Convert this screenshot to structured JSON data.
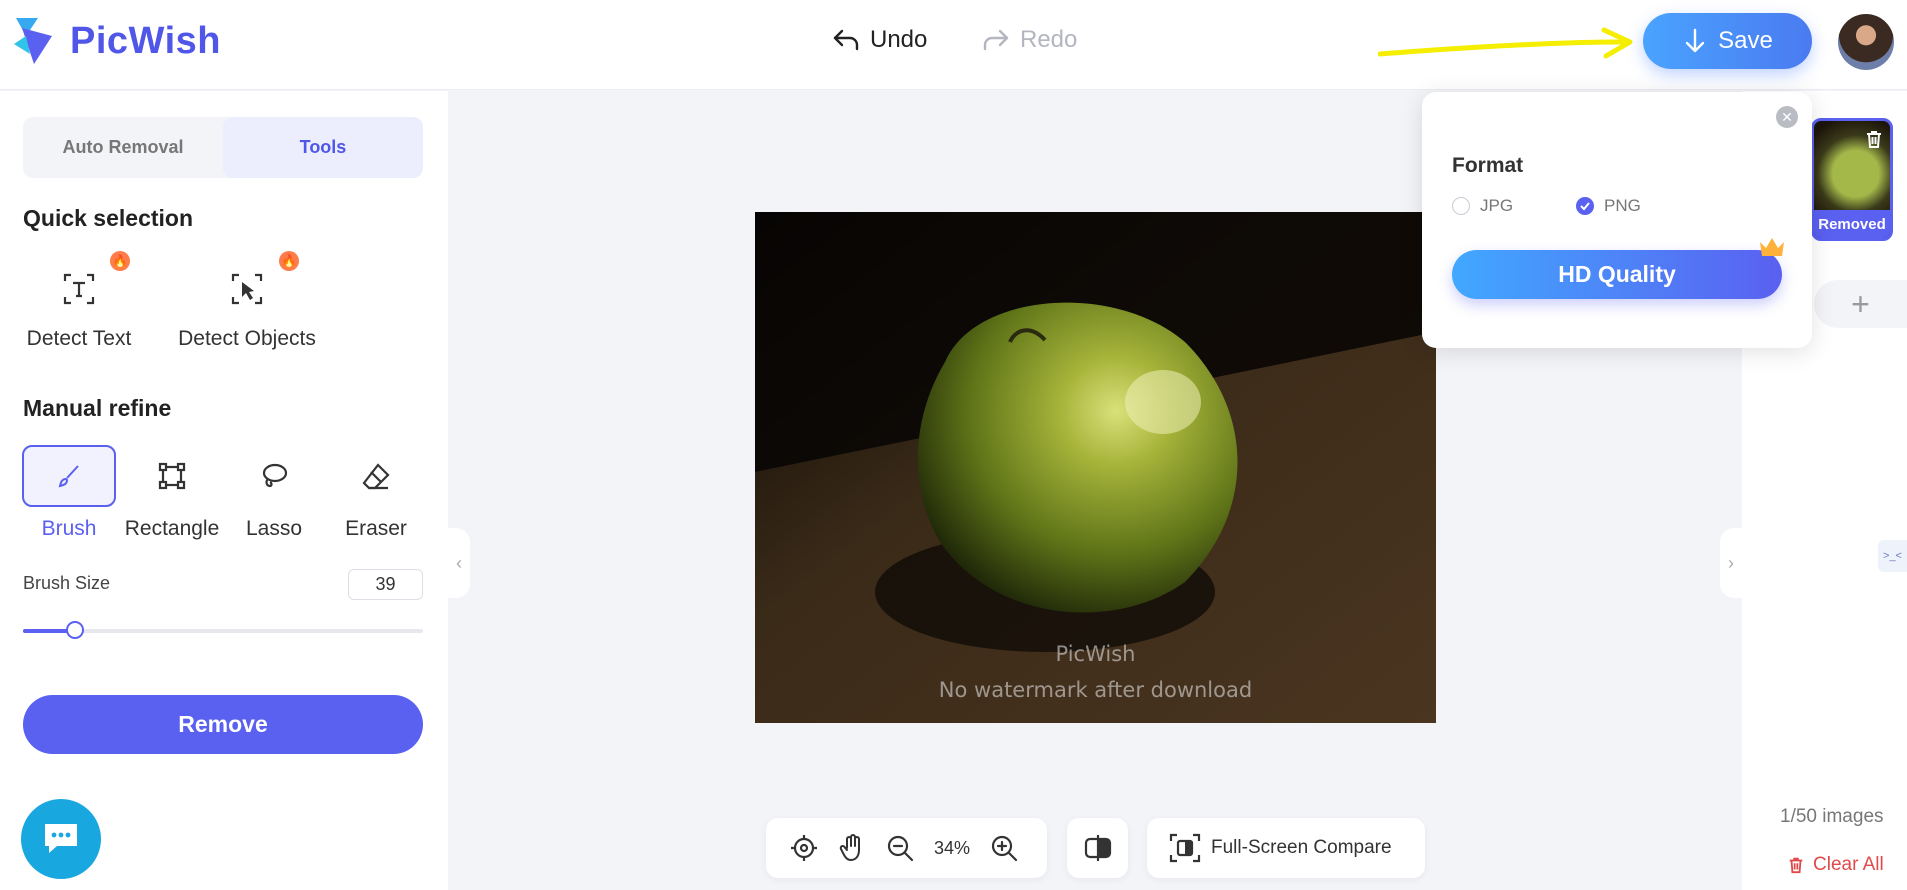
{
  "app": {
    "name": "PicWish"
  },
  "header": {
    "undo_label": "Undo",
    "redo_label": "Redo",
    "save_label": "Save"
  },
  "left_panel": {
    "tabs": [
      {
        "label": "Auto Removal",
        "active": false
      },
      {
        "label": "Tools",
        "active": true
      }
    ],
    "quick_selection": {
      "title": "Quick selection",
      "tools": [
        {
          "label": "Detect Text",
          "icon": "detect-text-icon"
        },
        {
          "label": "Detect Objects",
          "icon": "detect-objects-icon"
        }
      ]
    },
    "manual_refine": {
      "title": "Manual refine",
      "tools": [
        {
          "label": "Brush",
          "icon": "brush-icon",
          "active": true
        },
        {
          "label": "Rectangle",
          "icon": "rectangle-icon",
          "active": false
        },
        {
          "label": "Lasso",
          "icon": "lasso-icon",
          "active": false
        },
        {
          "label": "Eraser",
          "icon": "eraser-icon",
          "active": false
        }
      ]
    },
    "brush_size": {
      "label": "Brush Size",
      "value": "39",
      "fraction": 0.13
    },
    "remove_label": "Remove"
  },
  "canvas": {
    "watermark_brand": "PicWish",
    "watermark_note": "No watermark after download",
    "zoom": "34%",
    "fullscreen_compare_label": "Full-Screen Compare"
  },
  "format_popup": {
    "title": "Format",
    "options": [
      {
        "label": "JPG",
        "selected": false
      },
      {
        "label": "PNG",
        "selected": true
      }
    ],
    "hd_label": "HD Quality"
  },
  "right_panel": {
    "thumbnail_badge": "Removed",
    "count": "1/50 images",
    "clear_label": "Clear All"
  },
  "colors": {
    "brand": "#4f56e8",
    "accent": "#5a60f0",
    "save_gradient_start": "#4aa3ff",
    "danger": "#e04a4a",
    "annotation_arrow": "#f5ee00"
  }
}
